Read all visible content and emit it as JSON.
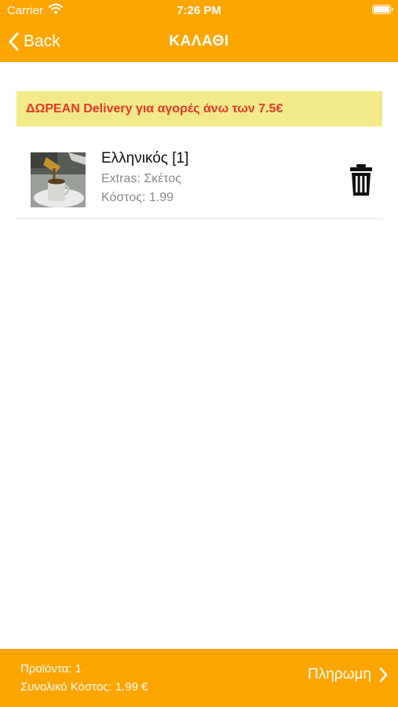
{
  "status_bar": {
    "carrier": "Carrier",
    "time": "7:26 PM",
    "icons": [
      "wifi-icon",
      "battery-icon"
    ]
  },
  "nav": {
    "back_label": "Back",
    "title": "ΚΑΛΑΘΙ"
  },
  "promo": {
    "text": "ΔΩΡΕΑΝ Delivery για αγορές άνω των 7.5€"
  },
  "cart": {
    "items": [
      {
        "name": "Ελληνικός [1]",
        "extras": "Extras: Σκέτος",
        "cost": "Κόστος: 1.99",
        "thumbnail_icon": "greek-coffee-photo",
        "delete_icon": "trash-icon"
      }
    ]
  },
  "footer": {
    "products": "Προϊόντα: 1",
    "total": "Συνολικό Κόστος: 1.99 €",
    "pay_label": "Πληρωμη"
  },
  "colors": {
    "accent": "#FFA500",
    "promo_background": "#F2EA88",
    "promo_text": "#E8352B"
  }
}
